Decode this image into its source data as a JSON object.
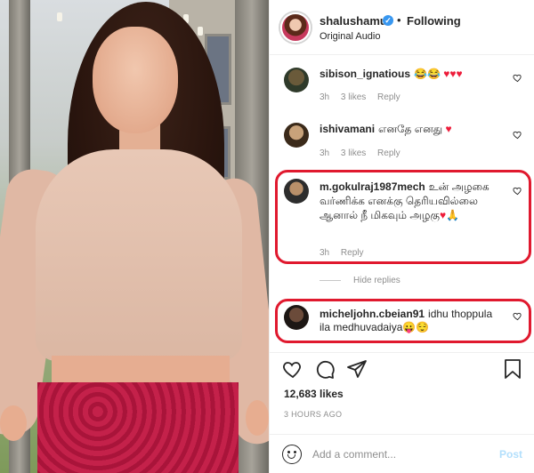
{
  "post": {
    "username": "shalushamu",
    "verified_mark": "✓",
    "separator": "•",
    "follow_status": "Following",
    "audio": "Original Audio",
    "more": "•••",
    "likes": "12,683 likes",
    "timestamp": "3 HOURS AGO",
    "comment_placeholder": "Add a comment...",
    "post_label": "Post"
  },
  "comments": [
    {
      "user": "sibison_ignatious",
      "text": "😂😂",
      "hearts": "♥♥♥",
      "time": "3h",
      "likes": "3 likes",
      "reply": "Reply"
    },
    {
      "user": "ishivamani",
      "text": "எனதே எனது",
      "hearts": "♥",
      "time": "3h",
      "likes": "3 likes",
      "reply": "Reply"
    },
    {
      "user": "m.gokulraj1987mech",
      "text": "உன் அழகை வர்ணிக்க எனக்கு தெரியவில்லை ஆனால் நீ மிகவும் அழகு",
      "hearts": "♥🙏",
      "time": "3h",
      "reply": "Reply"
    },
    {
      "user": "micheljohn.cbeian91",
      "text": "idhu thoppula ila medhuvadaiya",
      "emoji": "😛😌"
    }
  ],
  "hide_replies": "Hide replies",
  "icons": {
    "heart": "heart-icon",
    "comment": "comment-icon",
    "share": "share-icon",
    "bookmark": "bookmark-icon",
    "emoji": "emoji-icon"
  },
  "colors": {
    "highlight": "#e0192e",
    "verified": "#3897f0",
    "heart_red": "#ed1c3a",
    "post_button": "#b2dffc"
  }
}
